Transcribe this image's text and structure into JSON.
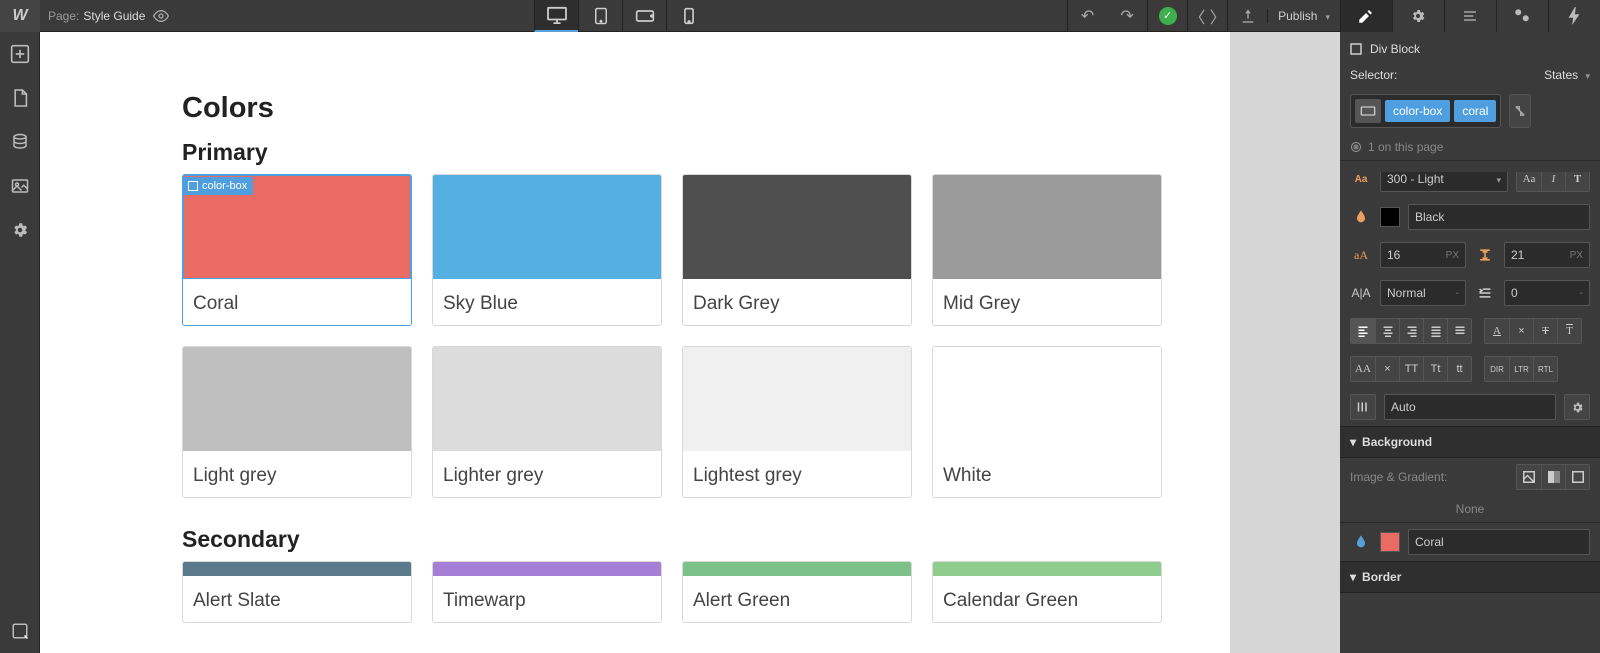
{
  "topbar": {
    "page_label": "Page:",
    "page_name": "Style Guide",
    "publish_label": "Publish"
  },
  "canvas": {
    "heading": "Colors",
    "primary_heading": "Primary",
    "secondary_heading": "Secondary",
    "selection_tag": "color-box",
    "primary_colors": [
      {
        "name": "Coral",
        "class": "swatch-coral"
      },
      {
        "name": "Sky Blue",
        "class": "swatch-sky"
      },
      {
        "name": "Dark Grey",
        "class": "swatch-darkgrey"
      },
      {
        "name": "Mid Grey",
        "class": "swatch-midgrey"
      },
      {
        "name": "Light grey",
        "class": "swatch-lightgrey"
      },
      {
        "name": "Lighter grey",
        "class": "swatch-lightergrey"
      },
      {
        "name": "Lightest grey",
        "class": "swatch-lightestgrey"
      },
      {
        "name": "White",
        "class": "swatch-white"
      }
    ],
    "secondary_colors": [
      {
        "name": "Alert Slate",
        "class": "swatch-slate"
      },
      {
        "name": "Timewarp",
        "class": "swatch-timewarp"
      },
      {
        "name": "Alert Green",
        "class": "swatch-green"
      },
      {
        "name": "Calendar Green",
        "class": "swatch-calgreen"
      }
    ]
  },
  "panel": {
    "element_type": "Div Block",
    "selector_label": "Selector:",
    "states_label": "States",
    "selector_tags": [
      "color-box",
      "coral"
    ],
    "instances_text": "1 on this page",
    "font_weight": "300 - Light",
    "color_name": "Black",
    "font_size": "16",
    "line_height": "21",
    "unit": "PX",
    "letter_spacing": "Normal",
    "indent": "0",
    "columns_value": "Auto",
    "background_heading": "Background",
    "img_gradient_label": "Image & Gradient:",
    "img_gradient_value": "None",
    "bg_color_name": "Coral",
    "border_heading": "Border",
    "caps_opts": [
      "×",
      "TT",
      "Tt",
      "tt"
    ],
    "dir_opts": [
      "DIR",
      "LTR",
      "RTL"
    ]
  }
}
